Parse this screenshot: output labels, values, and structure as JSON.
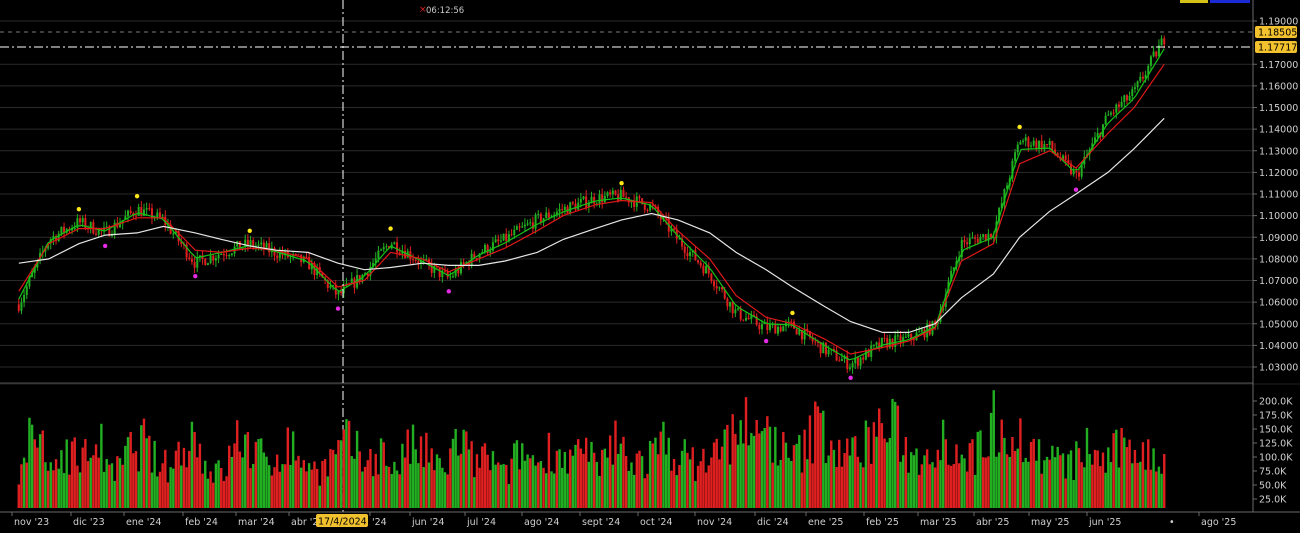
{
  "header": {
    "clock": "06:12:56",
    "clock_marker": "×"
  },
  "price_axis": {
    "ticks": [
      "1.19000",
      "1.17000",
      "1.16000",
      "1.15000",
      "1.14000",
      "1.13000",
      "1.12000",
      "1.11000",
      "1.10000",
      "1.09000",
      "1.08000",
      "1.07000",
      "1.06000",
      "1.05000",
      "1.04000",
      "1.03000"
    ]
  },
  "price_tags": {
    "current": "1.18505",
    "crosshair": "1.17717"
  },
  "volume_axis": {
    "ticks": [
      "200.0K",
      "175.0K",
      "150.0K",
      "125.0K",
      "100.0K",
      "75.0K",
      "50.0K",
      "25.0K"
    ]
  },
  "time_axis": {
    "labels": [
      "nov '23",
      "dic '23",
      "ene '24",
      "feb '24",
      "mar '24",
      "abr '24",
      "'24",
      "jun '24",
      "jul '24",
      "ago '24",
      "sept '24",
      "oct '24",
      "nov '24",
      "dic '24",
      "ene '25",
      "feb '25",
      "mar '25",
      "abr '25",
      "may '25",
      "jun '25",
      "ago '25"
    ],
    "crosshair_date": "17/4/2024",
    "future_marker": "•"
  },
  "colors": {
    "background": "#000000",
    "grid": "#2a2a2a",
    "candle_up": "#22b022",
    "candle_down": "#e02020",
    "ma_fast": "#16c216",
    "ma_mid": "#e01818",
    "ma_slow": "#e6e6e6",
    "swing_high": "#ffe81a",
    "swing_low": "#e52be5",
    "tag_bg": "#f2c12e",
    "crosshair": "#ffffff"
  },
  "chart_data": [
    {
      "type": "line",
      "title": "",
      "ylim": [
        1.025,
        1.195
      ],
      "y_ticks": [
        1.19,
        1.17,
        1.16,
        1.15,
        1.14,
        1.13,
        1.12,
        1.11,
        1.1,
        1.09,
        1.08,
        1.07,
        1.06,
        1.05,
        1.04,
        1.03
      ],
      "x": [
        "2023-10-30",
        "2023-11-15",
        "2023-12-01",
        "2023-12-15",
        "2024-01-01",
        "2024-01-15",
        "2024-02-01",
        "2024-02-15",
        "2024-03-01",
        "2024-03-15",
        "2024-04-01",
        "2024-04-17",
        "2024-05-01",
        "2024-05-15",
        "2024-06-01",
        "2024-06-15",
        "2024-07-01",
        "2024-07-15",
        "2024-08-01",
        "2024-08-15",
        "2024-09-01",
        "2024-09-15",
        "2024-10-01",
        "2024-10-15",
        "2024-11-01",
        "2024-11-15",
        "2024-12-01",
        "2024-12-15",
        "2025-01-01",
        "2025-01-15",
        "2025-02-01",
        "2025-02-15",
        "2025-03-01",
        "2025-03-15",
        "2025-04-01",
        "2025-04-15",
        "2025-05-01",
        "2025-05-15",
        "2025-06-01",
        "2025-06-15",
        "2025-07-01"
      ],
      "series": [
        {
          "values": [
            1.059,
            1.089,
            1.097,
            1.092,
            1.103,
            1.098,
            1.078,
            1.083,
            1.087,
            1.083,
            1.078,
            1.063,
            1.073,
            1.088,
            1.078,
            1.071,
            1.083,
            1.089,
            1.098,
            1.103,
            1.108,
            1.109,
            1.104,
            1.089,
            1.073,
            1.055,
            1.048,
            1.049,
            1.038,
            1.031,
            1.041,
            1.043,
            1.049,
            1.087,
            1.092,
            1.135,
            1.132,
            1.118,
            1.146,
            1.157,
            1.182
          ]
        },
        {
          "values": [
            1.065,
            1.087,
            1.094,
            1.094,
            1.099,
            1.099,
            1.084,
            1.083,
            1.085,
            1.084,
            1.08,
            1.067,
            1.07,
            1.083,
            1.08,
            1.074,
            1.08,
            1.085,
            1.093,
            1.1,
            1.105,
            1.107,
            1.106,
            1.093,
            1.08,
            1.063,
            1.053,
            1.05,
            1.043,
            1.036,
            1.039,
            1.042,
            1.048,
            1.079,
            1.087,
            1.124,
            1.13,
            1.122,
            1.138,
            1.15,
            1.17
          ]
        },
        {
          "values": [
            1.078,
            1.08,
            1.087,
            1.091,
            1.092,
            1.095,
            1.092,
            1.089,
            1.086,
            1.084,
            1.083,
            1.078,
            1.075,
            1.076,
            1.078,
            1.077,
            1.077,
            1.079,
            1.083,
            1.089,
            1.094,
            1.098,
            1.101,
            1.098,
            1.092,
            1.083,
            1.075,
            1.067,
            1.058,
            1.051,
            1.046,
            1.046,
            1.05,
            1.062,
            1.073,
            1.09,
            1.102,
            1.11,
            1.12,
            1.131,
            1.145
          ]
        }
      ]
    },
    {
      "type": "bar",
      "title": "",
      "ylim": [
        0,
        225000
      ],
      "y_ticks": [
        200000,
        175000,
        150000,
        125000,
        100000,
        75000,
        50000,
        25000
      ],
      "values": [
        80000,
        150000,
        70000,
        120000,
        90000,
        140000,
        60000,
        110000,
        130000,
        75000,
        95000,
        150000,
        80000,
        65000,
        140000,
        110000,
        85000,
        125000,
        100000,
        70000,
        95000,
        130000,
        90000,
        110000,
        80000,
        120000,
        105000,
        70000,
        135000,
        90000,
        100000,
        60000,
        115000,
        85000,
        120000,
        95000,
        110000,
        75000,
        130000,
        100000,
        90000,
        125000,
        110000,
        85000,
        100000,
        120000,
        180000,
        130000,
        150000,
        95000,
        110000,
        170000,
        120000,
        100000,
        130000,
        160000,
        150000,
        90000,
        120000,
        140000,
        110000,
        100000,
        170000,
        160000,
        130000,
        105000,
        95000,
        80000,
        120000,
        90000,
        110000,
        130000,
        100000,
        95000
      ]
    }
  ]
}
